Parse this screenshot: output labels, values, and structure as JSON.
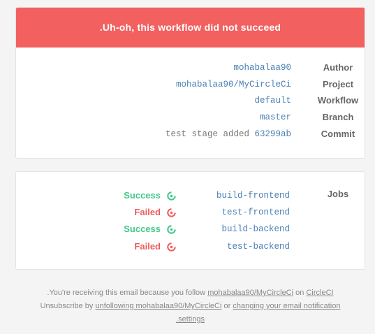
{
  "banner": {
    "title": ".Uh-oh, this workflow did not succeed",
    "color": "#f26060"
  },
  "details": [
    {
      "label": "Author",
      "value": "mohabalaa90"
    },
    {
      "label": "Project",
      "value": "mohabalaa90/MyCircleCi"
    },
    {
      "label": "Workflow",
      "value": "default"
    },
    {
      "label": "Branch",
      "value": "master"
    },
    {
      "label": "Commit",
      "message": "test stage added",
      "value": "63299ab"
    }
  ],
  "jobs": {
    "heading": "Jobs",
    "items": [
      {
        "status": "Success",
        "state": "success",
        "name": "build-frontend",
        "icon": "success-icon"
      },
      {
        "status": "Failed",
        "state": "failed",
        "name": "test-frontend",
        "icon": "failed-icon"
      },
      {
        "status": "Success",
        "state": "success",
        "name": "build-backend",
        "icon": "success-icon"
      },
      {
        "status": "Failed",
        "state": "failed",
        "name": "test-backend",
        "icon": "failed-icon"
      }
    ]
  },
  "footer": {
    "line1_prefix": ".You're receiving this email because you follow",
    "project_link": "mohabalaa90/MyCircleCi",
    "line1_on": "on",
    "circleci_link": "CircleCI",
    "line2_prefix": "Unsubscribe by",
    "unfollow_link": "unfollowing mohabalaa90/MyCircleCi",
    "line2_or": "or",
    "settings_link_part1": "changing your email notification",
    "settings_link_part2": ".settings"
  },
  "colors": {
    "success": "#42c88a",
    "failed": "#ed5c5c",
    "link": "#4a7fb5"
  }
}
